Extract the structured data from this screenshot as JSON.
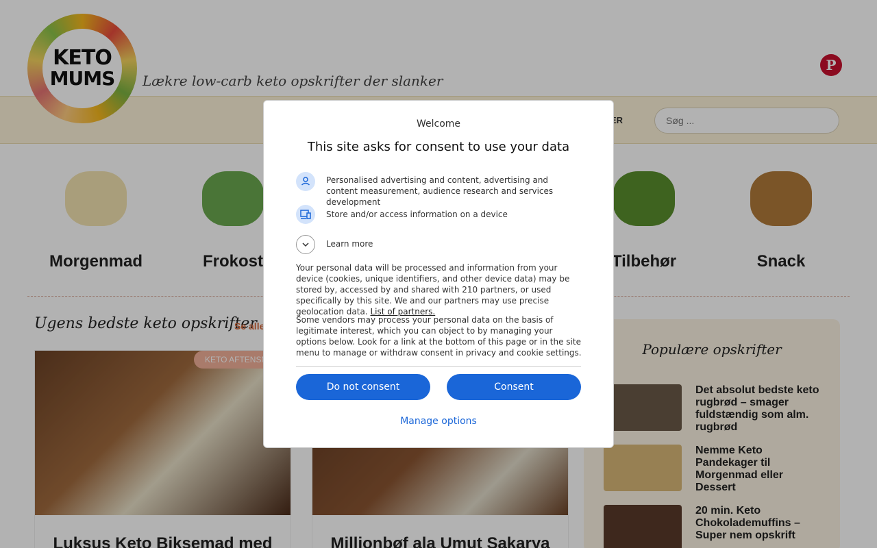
{
  "header": {
    "logo_top": "KETO",
    "logo_bottom": "MUMS",
    "tagline": "Lækre low-carb keto opskrifter der slanker",
    "social_icon": "pinterest-icon"
  },
  "nav": {
    "visible_item": "IKLER",
    "search_placeholder": "Søg ..."
  },
  "categories": [
    {
      "label": "Morgenmad",
      "color": "#f3e2b0"
    },
    {
      "label": "Frokost",
      "color": "#6aa84f"
    },
    {
      "label": "Tilbehør",
      "color": "#5a8f2d"
    },
    {
      "label": "Snack",
      "color": "#b07a3a"
    }
  ],
  "main": {
    "section_title": "Ugens bedste keto opskrifter",
    "see_all": "Se alle",
    "cards": [
      {
        "tag": "KETO AFTENSM",
        "title": "Luksus Keto Biksemad med",
        "color": "#8a5a3a"
      },
      {
        "tag": "",
        "title": "Millionbøf ala Umut Sakarya",
        "color": "#7a4a2a"
      }
    ]
  },
  "sidebar": {
    "title": "Populære opskrifter",
    "items": [
      {
        "title": "Det absolut bedste keto rugbrød – smager fuldstændig som alm. rugbrød",
        "color": "#6b5a48"
      },
      {
        "title": "Nemme Keto Pandekager til Morgenmad eller Dessert",
        "color": "#d9b878"
      },
      {
        "title": "20 min. Keto Chokolademuffins – Super nem opskrift",
        "color": "#5a3a2a"
      }
    ]
  },
  "dialog": {
    "welcome": "Welcome",
    "heading": "This site asks for consent to use your data",
    "purposes": [
      {
        "icon": "person-icon",
        "text": "Personalised advertising and content, advertising and content measurement, audience research and services development"
      },
      {
        "icon": "devices-icon",
        "text": "Store and/or access information on a device"
      }
    ],
    "learn_more": "Learn more",
    "para1": "Your personal data will be processed and information from your device (cookies, unique identifiers, and other device data) may be stored by, accessed by and shared with 210 partners, or used specifically by this site. We and our partners may use precise geolocation data.",
    "partners_link": "List of partners.",
    "para2": "Some vendors may process your personal data on the basis of legitimate interest, which you can object to by managing your options below. Look for a link at the bottom of this page or in the site menu to manage or withdraw consent in privacy and cookie settings.",
    "do_not_consent": "Do not consent",
    "consent": "Consent",
    "manage": "Manage options",
    "accent": "#1a66d8"
  }
}
